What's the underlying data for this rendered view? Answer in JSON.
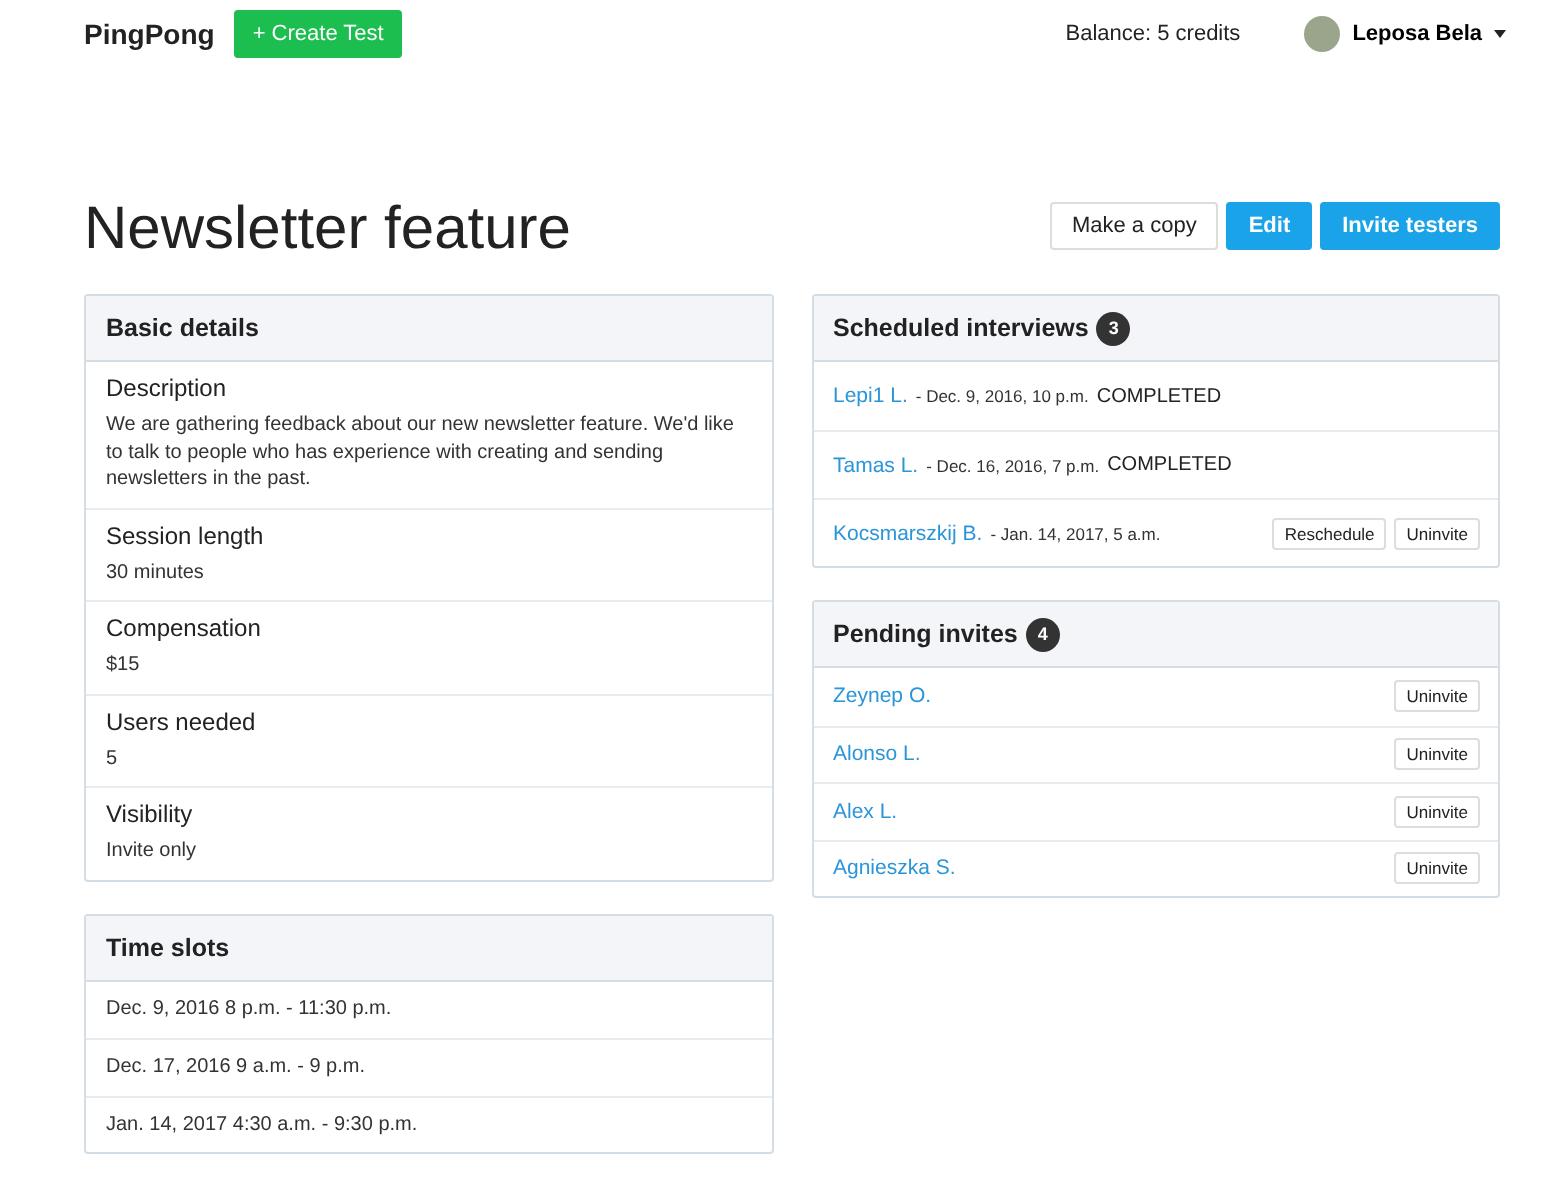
{
  "navbar": {
    "brand": "PingPong",
    "create_button": "+ Create Test",
    "balance": "Balance: 5 credits",
    "user": "Leposa Bela"
  },
  "header": {
    "title": "Newsletter feature",
    "buttons": [
      {
        "label": "Make a copy",
        "kind": "default"
      },
      {
        "label": "Edit",
        "kind": "primary"
      },
      {
        "label": "Invite testers",
        "kind": "primary"
      }
    ]
  },
  "basic_details": {
    "title": "Basic details",
    "fields": [
      {
        "label": "Description",
        "value": "We are gathering feedback about our new newsletter feature. We'd like to talk to people who has experience with creating and sending newsletters in the past."
      },
      {
        "label": "Session length",
        "value": "30 minutes"
      },
      {
        "label": "Compensation",
        "value": "$15"
      },
      {
        "label": "Users needed",
        "value": "5"
      },
      {
        "label": "Visibility",
        "value": "Invite only"
      }
    ]
  },
  "time_slots": {
    "title": "Time slots",
    "items": [
      "Dec. 9, 2016 8 p.m. - 11:30 p.m.",
      "Dec. 17, 2016 9 a.m. - 9 p.m.",
      "Jan. 14, 2017 4:30 a.m. - 9:30 p.m."
    ]
  },
  "scheduled_interviews": {
    "title": "Scheduled interviews",
    "count": "3",
    "items": [
      {
        "name": "Lepi1 L.",
        "when": "- Dec. 9, 2016, 10 p.m.",
        "status": "COMPLETED"
      },
      {
        "name": "Tamas L.",
        "when": "- Dec. 16, 2016, 7 p.m.",
        "status": "COMPLETED"
      },
      {
        "name": "Kocsmarszkij B.",
        "when": "- Jan. 14, 2017, 5 a.m.",
        "actions": [
          "Reschedule",
          "Uninvite"
        ]
      }
    ]
  },
  "pending_invites": {
    "title": "Pending invites",
    "count": "4",
    "items": [
      {
        "name": "Zeynep O.",
        "action": "Uninvite"
      },
      {
        "name": "Alonso L.",
        "action": "Uninvite"
      },
      {
        "name": "Alex L.",
        "action": "Uninvite"
      },
      {
        "name": "Agnieszka S.",
        "action": "Uninvite"
      }
    ]
  }
}
